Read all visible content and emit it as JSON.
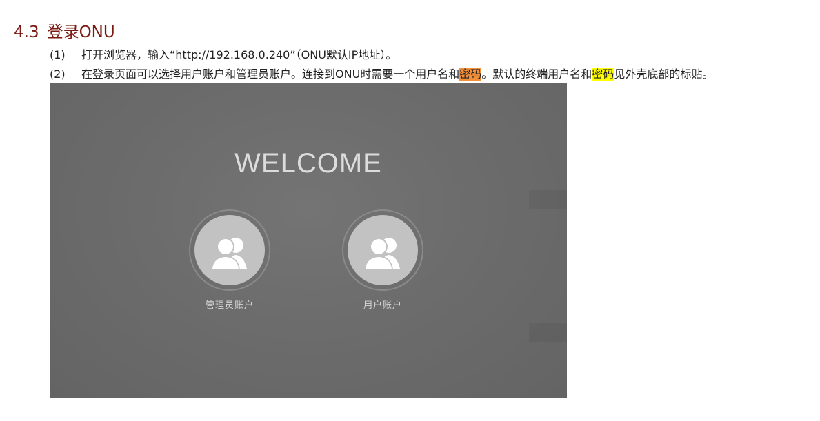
{
  "section": {
    "number": "4.3",
    "title": "登录ONU"
  },
  "steps": [
    {
      "index": "(1)",
      "text": "打开浏览器，输入“http://192.168.0.240”（ONU默认IP地址）。"
    },
    {
      "index": "(2)",
      "text_part1": "在登录页面可以选择用户账户和管理员账户。连接到ONU时需要一个用户名和",
      "highlight1": "密码",
      "text_part2": "。默认的终端用户名和",
      "highlight2": "密码",
      "text_part3": "见外壳底部的标贴。"
    }
  ],
  "login_screen": {
    "welcome": "WELCOME",
    "accounts": [
      {
        "label": "管理员账户",
        "icon": "users-icon"
      },
      {
        "label": "用户账户",
        "icon": "users-icon"
      }
    ]
  },
  "colors": {
    "heading": "#7a1a12",
    "highlight_orange": "#f4903a",
    "highlight_yellow": "#ffff00",
    "screen_bg": "#6c6c6c"
  }
}
